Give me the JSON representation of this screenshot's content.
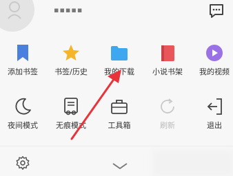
{
  "header": {
    "username": "▪▪▪▪▪",
    "avatar_icon": "user-icon",
    "message_icon": "message-icon"
  },
  "row1": [
    {
      "label": "添加书签",
      "icon": "bookmark-icon",
      "color": "#4a7fe0"
    },
    {
      "label": "书签/历史",
      "icon": "star-icon",
      "color": "#f5b52a"
    },
    {
      "label": "我的下载",
      "icon": "folder-icon",
      "color": "#3da8ef"
    },
    {
      "label": "小说书架",
      "icon": "book-icon",
      "color": "#e8555a"
    },
    {
      "label": "我的视频",
      "icon": "play-icon",
      "color": "#9b72e6"
    }
  ],
  "row2": [
    {
      "label": "夜间模式",
      "icon": "moon-icon",
      "disabled": false
    },
    {
      "label": "无痕模式",
      "icon": "incognito-icon",
      "disabled": false
    },
    {
      "label": "工具箱",
      "icon": "toolbox-icon",
      "disabled": false
    },
    {
      "label": "刷新",
      "icon": "refresh-icon",
      "disabled": true
    },
    {
      "label": "退出",
      "icon": "exit-icon",
      "disabled": false
    }
  ],
  "bottom": {
    "settings_icon": "gear-icon",
    "collapse_icon": "chevron-down-icon"
  },
  "annotation": {
    "arrow_color": "#e8333a"
  }
}
